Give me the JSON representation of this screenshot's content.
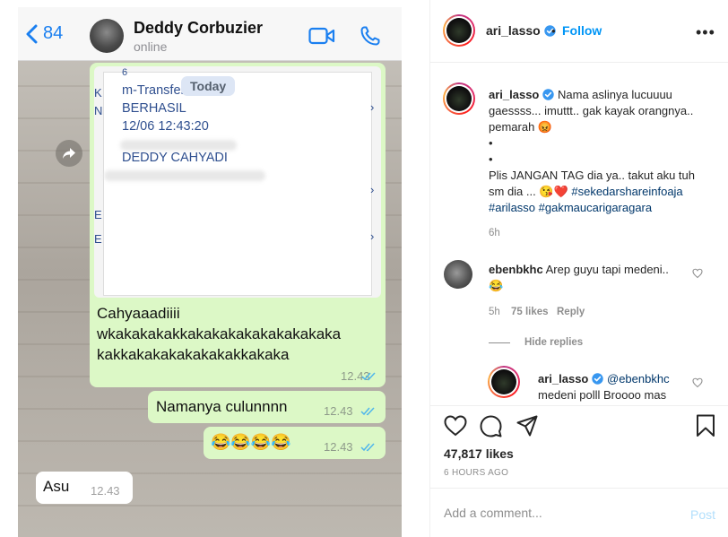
{
  "whatsapp": {
    "back_count": "84",
    "contact_name": "Deddy Corbuzier",
    "contact_status": "online",
    "date_pill": "Today",
    "receipt": {
      "line0": "6",
      "line1": "m-Transfer",
      "line2": "BERHASIL",
      "line3": "12/06 12:43:20",
      "line4": "DEDDY CAHYADI"
    },
    "messages": [
      {
        "text_lines": [
          "Cahyaaadiiii",
          "wkakakakakkakakakakakakakakaka",
          "kakkakakakakakakakkakaka"
        ],
        "time": "12.43",
        "direction": "out"
      },
      {
        "text": "Namanya culunnnn",
        "time": "12.43",
        "direction": "out"
      },
      {
        "text": "😂😂😂😂",
        "time": "12.43",
        "direction": "out"
      },
      {
        "text": "Asu",
        "time": "12.43",
        "direction": "in"
      }
    ]
  },
  "post": {
    "username": "ari_lasso",
    "follow_label": "Follow",
    "separator": "•",
    "more_icon": "more-horizontal-icon",
    "caption": {
      "username": "ari_lasso",
      "line1": "Nama aslinya lucuuuu",
      "line2": "gaessss... imuttt.. gak kayak orangnya..",
      "line3": "pemarah 😡",
      "line4": "•",
      "line5": "•",
      "line6": "Plis JANGAN TAG dia ya.. takut aku tuh",
      "line7": "sm dia ... 😘❤️",
      "hashtag1": "#sekedarshareinfoaja",
      "hashtag2": "#arilasso",
      "hashtag3": "#gakmaucarigaragara",
      "time": "6h"
    },
    "comments": [
      {
        "username": "ebenbkhc",
        "text_line1": "Arep guyu tapi medeni..",
        "text_line2": "😂",
        "time": "5h",
        "likes": "75 likes",
        "reply_label": "Reply",
        "hide_replies": "Hide replies"
      },
      {
        "username": "ari_lasso",
        "mention": "@ebenbkhc",
        "text_line2": "medeni polll Broooo mas"
      }
    ],
    "likes": "47,817 likes",
    "timestamp": "6 HOURS AGO",
    "comment_placeholder": "Add a comment...",
    "post_label": "Post"
  },
  "colors": {
    "accent": "#0095f6",
    "whatsapp_blue": "#1a7ff0",
    "bubble_out": "#dcf8c6",
    "hashtag": "#00376b",
    "read_ticks": "#4fb6ec"
  }
}
